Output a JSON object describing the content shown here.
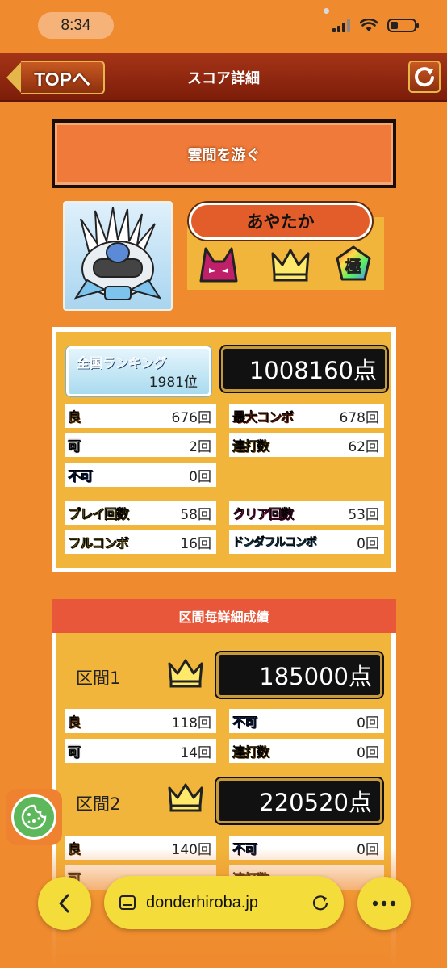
{
  "status_bar": {
    "time": "8:34"
  },
  "header": {
    "back_label": "TOPへ",
    "title": "スコア詳細"
  },
  "song": {
    "title": "雲間を游ぐ"
  },
  "player": {
    "name": "あやたか",
    "badges": [
      "oni-difficulty-icon",
      "crown-icon",
      "kiwami-icon"
    ]
  },
  "score": {
    "ranking_label": "全国ランキング",
    "ranking_value": "1981位",
    "total": "1008160点",
    "stats": {
      "good": {
        "label": "良",
        "value": "676回"
      },
      "ok": {
        "label": "可",
        "value": "2回"
      },
      "bad": {
        "label": "不可",
        "value": "0回"
      },
      "max_combo": {
        "label": "最大コンボ",
        "value": "678回"
      },
      "drumroll": {
        "label": "連打数",
        "value": "62回"
      },
      "play_count": {
        "label": "プレイ回数",
        "value": "58回"
      },
      "clear_count": {
        "label": "クリア回数",
        "value": "53回"
      },
      "full_combo": {
        "label": "フルコンボ",
        "value": "16回"
      },
      "donda_full_combo": {
        "label": "ドンダフルコンボ",
        "value": "0回"
      }
    }
  },
  "sections": {
    "title": "区間毎詳細成績",
    "s1": {
      "label": "区間1",
      "score": "185000点",
      "good": "118回",
      "ok": "14回",
      "bad": "0回",
      "drumroll": "0回"
    },
    "s2": {
      "label": "区間2",
      "score": "220520点",
      "good": "140回",
      "ok": "",
      "bad": "0回",
      "drumroll": ""
    }
  },
  "browser": {
    "url": "donderhiroba.jp"
  }
}
